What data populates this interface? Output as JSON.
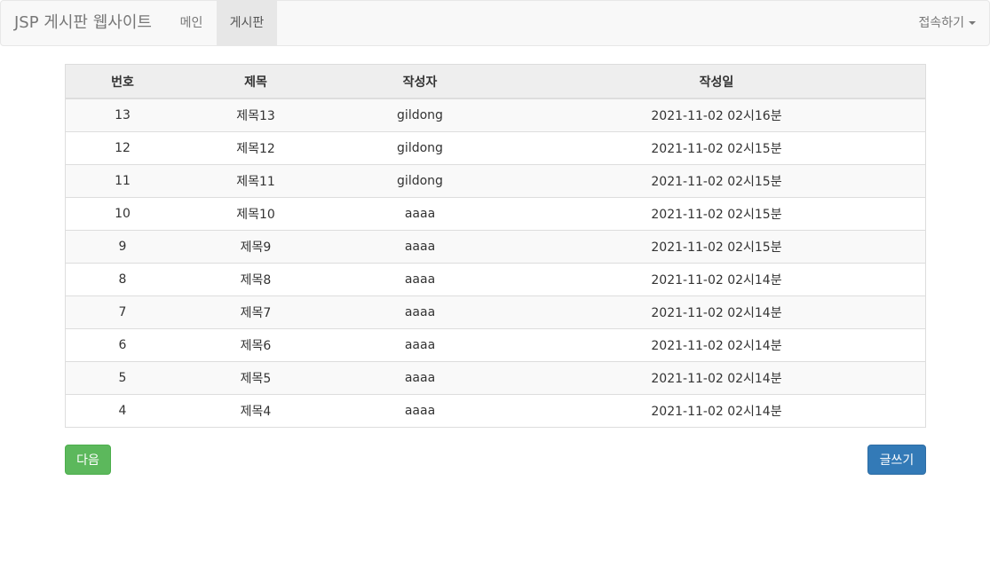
{
  "navbar": {
    "brand": "JSP 게시판 웹사이트",
    "items": [
      "메인",
      "게시판"
    ],
    "active_item": "게시판",
    "dropdown_label": "접속하기"
  },
  "board": {
    "columns": [
      "번호",
      "제목",
      "작성자",
      "작성일"
    ],
    "rows": [
      {
        "no": "13",
        "title": "제목13",
        "writer": "gildong",
        "date": "2021-11-02 02시16분"
      },
      {
        "no": "12",
        "title": "제목12",
        "writer": "gildong",
        "date": "2021-11-02 02시15분"
      },
      {
        "no": "11",
        "title": "제목11",
        "writer": "gildong",
        "date": "2021-11-02 02시15분"
      },
      {
        "no": "10",
        "title": "제목10",
        "writer": "aaaa",
        "date": "2021-11-02 02시15분"
      },
      {
        "no": "9",
        "title": "제목9",
        "writer": "aaaa",
        "date": "2021-11-02 02시15분"
      },
      {
        "no": "8",
        "title": "제목8",
        "writer": "aaaa",
        "date": "2021-11-02 02시14분"
      },
      {
        "no": "7",
        "title": "제목7",
        "writer": "aaaa",
        "date": "2021-11-02 02시14분"
      },
      {
        "no": "6",
        "title": "제목6",
        "writer": "aaaa",
        "date": "2021-11-02 02시14분"
      },
      {
        "no": "5",
        "title": "제목5",
        "writer": "aaaa",
        "date": "2021-11-02 02시14분"
      },
      {
        "no": "4",
        "title": "제목4",
        "writer": "aaaa",
        "date": "2021-11-02 02시14분"
      }
    ]
  },
  "buttons": {
    "next_label": "다음",
    "write_label": "글쓰기"
  },
  "colors": {
    "next_button": "#5cb85c",
    "write_button": "#337ab7",
    "navbar_bg": "#f8f8f8",
    "active_nav_bg": "#e7e7e7"
  }
}
